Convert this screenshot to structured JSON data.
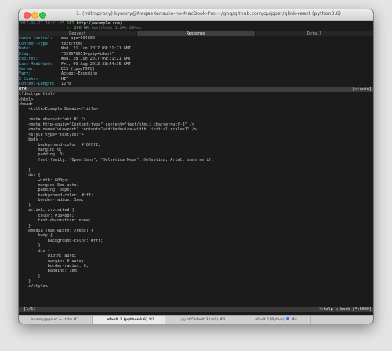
{
  "window": {
    "title": "1. (mitmproxy) kyanny@NagaeKensuke-no-MacBook-Pro:~/ghq/github.com/quipper/qlink-react (python3.6)"
  },
  "flow": {
    "line1": {
      "time": "2017-06-27 18:21:25",
      "method": "GET",
      "url": "http://example.com/"
    },
    "line2": {
      "arrow": "<-",
      "status": "200 OK",
      "type": "text/html",
      "size": "1.24k",
      "duration": "294ms"
    }
  },
  "view_tabs": [
    {
      "label": "Request",
      "active": false
    },
    {
      "label": "Response",
      "active": true
    },
    {
      "label": "Detail",
      "active": false
    }
  ],
  "headers": [
    {
      "key": "Cache-Control:",
      "value": "max-age=604800"
    },
    {
      "key": "Content-Type:",
      "value": "text/html"
    },
    {
      "key": "Date:",
      "value": "Wed, 21 Jun 2017 09:31:21 GMT"
    },
    {
      "key": "Etag:",
      "value": "\"359670651+gzip+ident\""
    },
    {
      "key": "Expires:",
      "value": "Wed, 28 Jun 2017 09:31:21 GMT"
    },
    {
      "key": "Last-Modified:",
      "value": "Fri, 09 Aug 2013 23:54:35 GMT"
    },
    {
      "key": "Server:",
      "value": "ECS (cpm/F9FC)"
    },
    {
      "key": "Vary:",
      "value": "Accept-Encoding"
    },
    {
      "key": "X-Cache:",
      "value": "HIT"
    },
    {
      "key": "Content-Length:",
      "value": "1270"
    }
  ],
  "body_bar": {
    "label": "HTML",
    "mode_open": "[",
    "mode_key": "m",
    "mode_rest": ":auto]"
  },
  "body_lines": [
    "<!doctype html>",
    "<html>",
    "<head>",
    "    <title>Example Domain</title>",
    "",
    "    <meta charset=\"utf-8\" />",
    "    <meta http-equiv=\"Content-type\" content=\"text/html; charset=utf-8\" />",
    "    <meta name=\"viewport\" content=\"width=device-width, initial-scale=1\" />",
    "    <style type=\"text/css\">",
    "    body {",
    "        background-color: #f0f0f2;",
    "        margin: 0;",
    "        padding: 0;",
    "        font-family: \"Open Sans\", \"Helvetica Neue\", Helvetica, Arial, sans-serif;",
    "",
    "    }",
    "    div {",
    "        width: 600px;",
    "        margin: 5em auto;",
    "        padding: 50px;",
    "        background-color: #fff;",
    "        border-radius: 1em;",
    "    }",
    "    a:link, a:visited {",
    "        color: #38488f;",
    "        text-decoration: none;",
    "    }",
    "    @media (max-width: 700px) {",
    "        body {",
    "            background-color: #fff;",
    "        }",
    "        div {",
    "            width: auto;",
    "            margin: 0 auto;",
    "            border-radius: 0;",
    "            padding: 1em;",
    "        }",
    "    }",
    "    </style>"
  ],
  "status_bar": {
    "position": "[1/1]",
    "help_key": "?",
    "help_label": ":help",
    "back_key": "q",
    "back_label": ":back",
    "port": "[*:8080]"
  },
  "terminal_tabs": [
    {
      "label": "kyanny@gaiac ~ (zsh)",
      "shortcut": "⌘1",
      "active": false,
      "activity": false
    },
    {
      "label": "...efault 2 (python3.6)",
      "shortcut": "⌘2",
      "active": true,
      "activity": false
    },
    {
      "label": "...py of Default 3 (zsh)",
      "shortcut": "⌘3",
      "active": false,
      "activity": false
    },
    {
      "label": "...efault 2 (Python)",
      "shortcut": "⌘4",
      "active": false,
      "activity": true
    }
  ]
}
